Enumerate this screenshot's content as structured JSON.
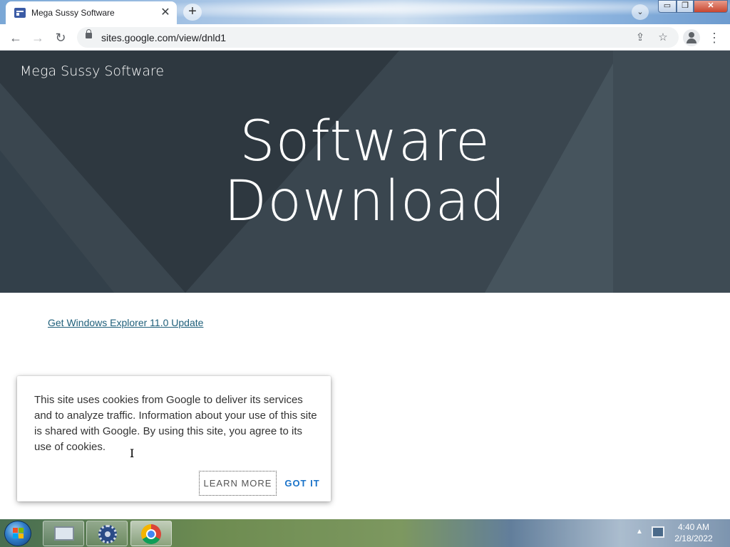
{
  "browser": {
    "tab_title": "Mega Sussy Software",
    "tab_close": "✕",
    "new_tab": "+",
    "tab_search": "⌄",
    "url": "sites.google.com/view/dnld1",
    "nav": {
      "back": "←",
      "forward": "→",
      "reload": "↻"
    },
    "actions": {
      "share": "⇪",
      "star": "☆",
      "menu": "⋮"
    },
    "window_controls": {
      "minimize": "▭",
      "maximize": "❐",
      "close": "✕"
    }
  },
  "site": {
    "name": "Mega Sussy Software",
    "hero_line1": "Software",
    "hero_line2": "Download",
    "download_link": "Get Windows Explorer 11.0 Update"
  },
  "cookie_banner": {
    "text": "This site uses cookies from Google to deliver its services and to analyze traffic. Information about your use of this site is shared with Google. By using this site, you agree to its use of cookies.",
    "learn_more": "LEARN MORE",
    "got_it": "GOT IT"
  },
  "taskbar": {
    "time": "4:40 AM",
    "date": "2/18/2022",
    "tray_arrow": "▲"
  },
  "colors": {
    "hero_bg": "#3a464f",
    "link": "#1f5f7a",
    "accent_button": "#1a73c9"
  }
}
